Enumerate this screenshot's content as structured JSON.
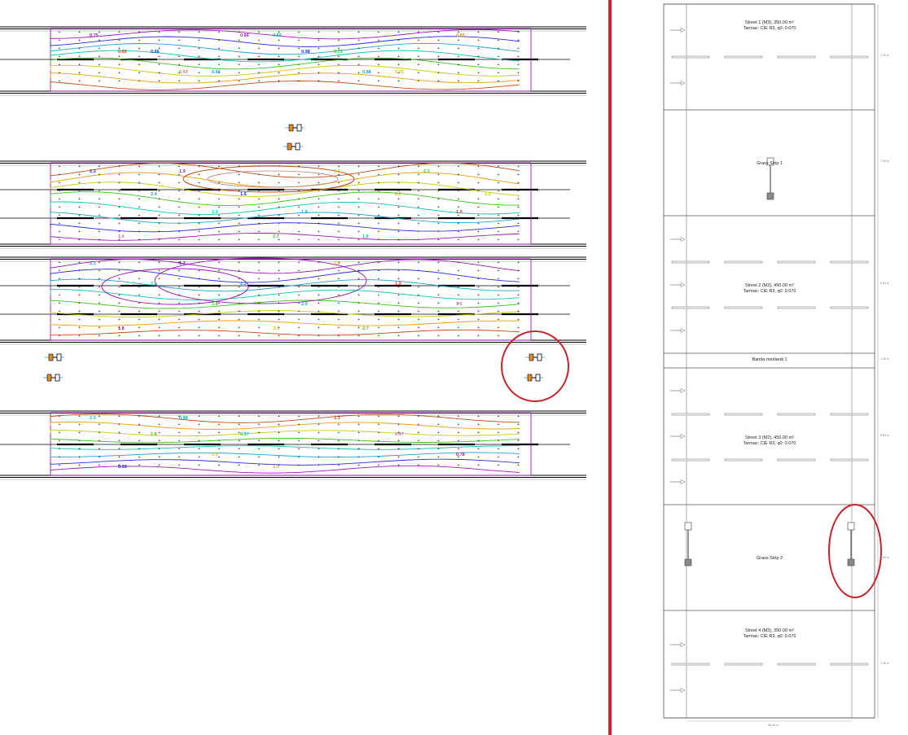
{
  "right_panel": {
    "areas": [
      {
        "name": "Street 1 (M3), 350.00 m²",
        "surface": "Tarmac: CIE R3, q0: 0.070"
      },
      {
        "name": "Grass Strip 1",
        "surface": ""
      },
      {
        "name": "Street 2 (M2), 450.00 m²",
        "surface": "Tarmac: CIE R3, q0: 0.070"
      },
      {
        "name": "Banda mediană 1",
        "surface": ""
      },
      {
        "name": "Street 3 (M2), 450.00 m²",
        "surface": "Tarmac: CIE R3, q0: 0.070"
      },
      {
        "name": "Grass Strip 2",
        "surface": ""
      },
      {
        "name": "Street 4 (M3), 350.00 m²",
        "surface": "Tarmac: CIE R3, q0: 0.070"
      }
    ],
    "dimensions": [
      "7.00 m",
      "7.00 m",
      "9.00 m",
      "1.00 m",
      "9.00 m",
      "7.00 m",
      "7.00 m",
      "36.00 m"
    ]
  },
  "contour_labels": [
    [
      "0.75",
      "0.66",
      "0.66",
      "0.58",
      "0.73",
      "0.75",
      "0.85",
      "0.65",
      "0.60",
      "0.66",
      "0.98",
      "0.88"
    ],
    [
      "2.3",
      "2.4",
      "2.3",
      "2.7",
      "2.3",
      "2.2",
      "1.9",
      "1.6",
      "1.9",
      "1.6",
      "1.8",
      "1.6",
      "2.1",
      "1.3"
    ],
    [
      "2.1",
      "2.5",
      "2.8",
      "3.1",
      "2.5",
      "1.9",
      "1.5",
      "1.8",
      "1.7",
      "2.3",
      "2.9",
      "2.7"
    ],
    [
      "2.0",
      "1.8",
      "1.6",
      "1.3",
      "1.1",
      "0.97",
      "0.78",
      "0.99",
      "0.88",
      "0.97"
    ]
  ],
  "colors": {
    "divider": "#d0232a",
    "annotation_circle": "#c8232c",
    "road_line": "#000000",
    "grid_frame": "#9a1ab0",
    "isolines": [
      "#9a1ab0",
      "#2a2ad0",
      "#20a0d0",
      "#10c0b0",
      "#40c020",
      "#c8c810",
      "#e8a010",
      "#b8501a",
      "#c08080"
    ]
  }
}
